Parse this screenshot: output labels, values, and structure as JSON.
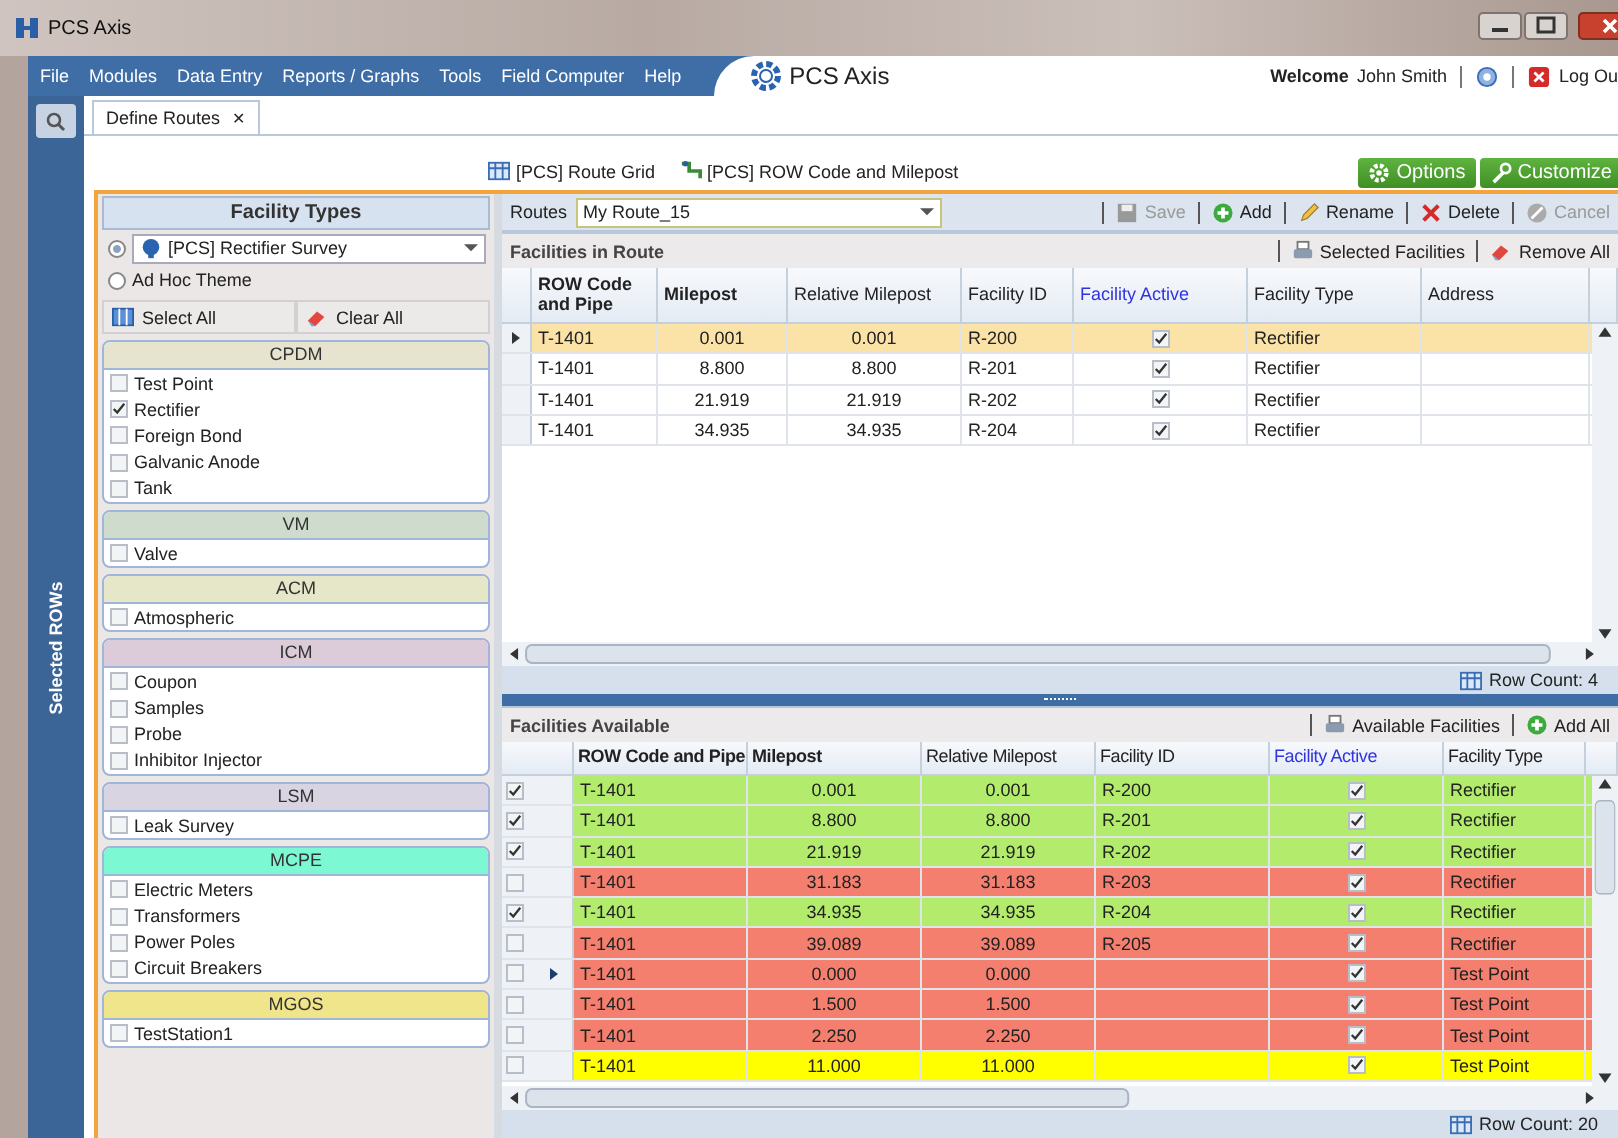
{
  "window": {
    "title": "PCS Axis"
  },
  "menu": [
    "File",
    "Modules",
    "Data Entry",
    "Reports / Graphs",
    "Tools",
    "Field Computer",
    "Help"
  ],
  "brand": "PCS Axis",
  "user": {
    "welcome": "Welcome",
    "name": "John Smith",
    "logout": "Log Ou"
  },
  "tabs": [
    {
      "label": "Define Routes",
      "selected": true,
      "close": "✕"
    }
  ],
  "side_strip": {
    "label": "Selected ROWs"
  },
  "toolbar": [
    {
      "label": "[PCS] Route Grid",
      "kind": "grid"
    },
    {
      "label": "[PCS] ROW Code and Milepost",
      "kind": "pipe"
    }
  ],
  "actions": [
    {
      "label": "Options",
      "kind": "gear"
    },
    {
      "label": "Customize",
      "kind": "wrench"
    }
  ],
  "facility_types": {
    "title": "Facility Types",
    "themes": [
      {
        "label": "[PCS] Rectifier Survey",
        "selected": true,
        "kind": "dropdown"
      },
      {
        "label": "Ad Hoc Theme",
        "selected": false,
        "kind": "plain"
      }
    ],
    "buttons": [
      {
        "label": "Select All",
        "kind": "grid"
      },
      {
        "label": "Clear All",
        "kind": "eraser"
      }
    ],
    "groups": [
      {
        "name": "CPDM",
        "color": "#e6e4cf",
        "items": [
          {
            "label": "Test Point",
            "checked": false
          },
          {
            "label": "Rectifier",
            "checked": true
          },
          {
            "label": "Foreign Bond",
            "checked": false
          },
          {
            "label": "Galvanic Anode",
            "checked": false
          },
          {
            "label": "Tank",
            "checked": false
          }
        ]
      },
      {
        "name": "VM",
        "color": "#cfdccd",
        "items": [
          {
            "label": "Valve",
            "checked": false
          }
        ]
      },
      {
        "name": "ACM",
        "color": "#e6e6c8",
        "items": [
          {
            "label": "Atmospheric",
            "checked": false
          }
        ]
      },
      {
        "name": "ICM",
        "color": "#dccbd8",
        "items": [
          {
            "label": "Coupon",
            "checked": false
          },
          {
            "label": "Samples",
            "checked": false
          },
          {
            "label": "Probe",
            "checked": false
          },
          {
            "label": "Inhibitor Injector",
            "checked": false
          }
        ]
      },
      {
        "name": "LSM",
        "color": "#d8d4e2",
        "items": [
          {
            "label": "Leak Survey",
            "checked": false
          }
        ]
      },
      {
        "name": "MCPE",
        "color": "#7cf8d2",
        "items": [
          {
            "label": "Electric Meters",
            "checked": false
          },
          {
            "label": "Transformers",
            "checked": false
          },
          {
            "label": "Power Poles",
            "checked": false
          },
          {
            "label": "Circuit Breakers",
            "checked": false
          }
        ]
      },
      {
        "name": "MGOS",
        "color": "#f0e58a",
        "items": [
          {
            "label": "TestStation1",
            "checked": false
          }
        ]
      }
    ]
  },
  "routes": {
    "label": "Routes",
    "value": "My Route_15",
    "buttons": [
      {
        "label": "Save",
        "kind": "save",
        "disabled": true
      },
      {
        "label": "Add",
        "kind": "add",
        "disabled": false
      },
      {
        "label": "Rename",
        "kind": "rename",
        "disabled": false
      },
      {
        "label": "Delete",
        "kind": "delete",
        "disabled": false
      },
      {
        "label": "Cancel",
        "kind": "cancel",
        "disabled": true
      }
    ]
  },
  "in_route": {
    "title": "Facilities in Route",
    "actions": [
      {
        "label": "Selected Facilities",
        "kind": "print"
      },
      {
        "label": "Remove All",
        "kind": "eraser"
      }
    ],
    "columns": [
      {
        "label": "ROW Code and Pipe",
        "bold": true,
        "kind": "text"
      },
      {
        "label": "Milepost",
        "bold": true,
        "kind": "number"
      },
      {
        "label": "Relative Milepost",
        "bold": false,
        "kind": "number"
      },
      {
        "label": "Facility ID",
        "bold": false,
        "kind": "text"
      },
      {
        "label": "Facility Active",
        "bold": false,
        "kind": "check"
      },
      {
        "label": "Facility Type",
        "bold": false,
        "kind": "text"
      },
      {
        "label": "Address",
        "bold": false,
        "kind": "text"
      }
    ],
    "rows": [
      {
        "selected": true,
        "row": "T-1401",
        "milepost": "0.001",
        "relative": "0.001",
        "facility_id": "R-200",
        "active": true,
        "type": "Rectifier"
      },
      {
        "selected": false,
        "row": "T-1401",
        "milepost": "8.800",
        "relative": "8.800",
        "facility_id": "R-201",
        "active": true,
        "type": "Rectifier"
      },
      {
        "selected": false,
        "row": "T-1401",
        "milepost": "21.919",
        "relative": "21.919",
        "facility_id": "R-202",
        "active": true,
        "type": "Rectifier"
      },
      {
        "selected": false,
        "row": "T-1401",
        "milepost": "34.935",
        "relative": "34.935",
        "facility_id": "R-204",
        "active": true,
        "type": "Rectifier"
      }
    ],
    "row_count_label": "Row Count:",
    "row_count": "4"
  },
  "available": {
    "title": "Facilities Available",
    "actions": [
      {
        "label": "Available Facilities",
        "kind": "print"
      },
      {
        "label": "Add All",
        "kind": "add"
      }
    ],
    "columns": [
      {
        "label": "ROW Code and Pipe",
        "bold": true,
        "kind": "text"
      },
      {
        "label": "Milepost",
        "bold": true,
        "kind": "number"
      },
      {
        "label": "Relative Milepost",
        "bold": false,
        "kind": "number"
      },
      {
        "label": "Facility ID",
        "bold": false,
        "kind": "text"
      },
      {
        "label": "Facility Active",
        "bold": false,
        "kind": "check"
      },
      {
        "label": "Facility Type",
        "bold": false,
        "kind": "text"
      }
    ],
    "rows": [
      {
        "checked": true,
        "selected": false,
        "color": "#b3ec6d",
        "row": "T-1401",
        "milepost": "0.001",
        "relative": "0.001",
        "facility_id": "R-200",
        "active": true,
        "type": "Rectifier"
      },
      {
        "checked": true,
        "selected": false,
        "color": "#b3ec6d",
        "row": "T-1401",
        "milepost": "8.800",
        "relative": "8.800",
        "facility_id": "R-201",
        "active": true,
        "type": "Rectifier"
      },
      {
        "checked": true,
        "selected": false,
        "color": "#b3ec6d",
        "row": "T-1401",
        "milepost": "21.919",
        "relative": "21.919",
        "facility_id": "R-202",
        "active": true,
        "type": "Rectifier"
      },
      {
        "checked": false,
        "selected": false,
        "color": "#f47f6f",
        "row": "T-1401",
        "milepost": "31.183",
        "relative": "31.183",
        "facility_id": "R-203",
        "active": true,
        "type": "Rectifier"
      },
      {
        "checked": true,
        "selected": false,
        "color": "#b3ec6d",
        "row": "T-1401",
        "milepost": "34.935",
        "relative": "34.935",
        "facility_id": "R-204",
        "active": true,
        "type": "Rectifier"
      },
      {
        "checked": false,
        "selected": false,
        "color": "#f47f6f",
        "row": "T-1401",
        "milepost": "39.089",
        "relative": "39.089",
        "facility_id": "R-205",
        "active": true,
        "type": "Rectifier"
      },
      {
        "checked": false,
        "selected": true,
        "color": "#f47f6f",
        "row": "T-1401",
        "milepost": "0.000",
        "relative": "0.000",
        "active": true,
        "type": "Test Point"
      },
      {
        "checked": false,
        "selected": false,
        "color": "#f47f6f",
        "row": "T-1401",
        "milepost": "1.500",
        "relative": "1.500",
        "active": true,
        "type": "Test Point"
      },
      {
        "checked": false,
        "selected": false,
        "color": "#f47f6f",
        "row": "T-1401",
        "milepost": "2.250",
        "relative": "2.250",
        "active": true,
        "type": "Test Point"
      },
      {
        "checked": false,
        "selected": false,
        "color": "#ffff00",
        "row": "T-1401",
        "milepost": "11.000",
        "relative": "11.000",
        "active": true,
        "type": "Test Point"
      }
    ],
    "row_count_label": "Row Count:",
    "row_count": "20"
  }
}
